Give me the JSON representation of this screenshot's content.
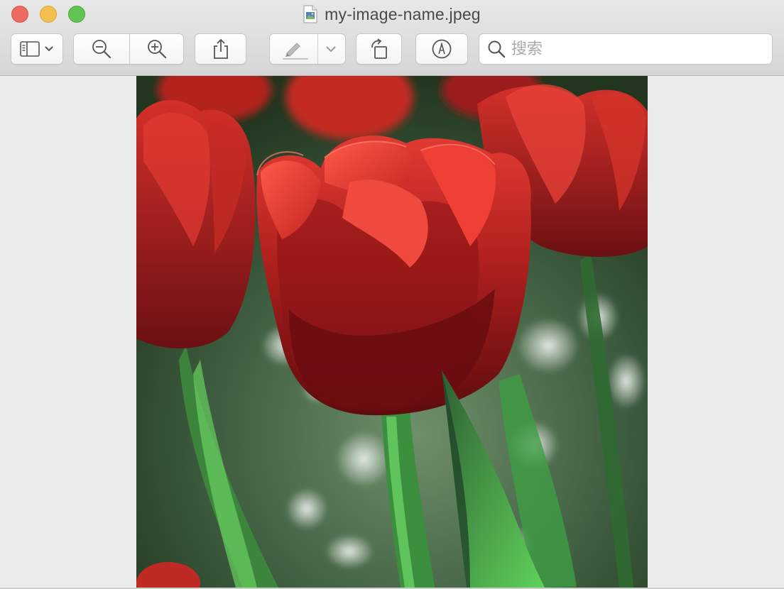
{
  "window": {
    "title": "my-image-name.jpeg"
  },
  "toolbar": {
    "sidebar_button": {
      "icon": "sidebar-icon",
      "menu_icon": "chevron-down-icon"
    },
    "zoom_out_button": {
      "icon": "zoom-out-icon"
    },
    "zoom_in_button": {
      "icon": "zoom-in-icon"
    },
    "share_button": {
      "icon": "share-icon"
    },
    "highlight_button": {
      "icon": "highlighter-pen-icon",
      "menu_icon": "chevron-down-icon"
    },
    "rotate_button": {
      "icon": "rotate-left-icon"
    },
    "markup_button": {
      "icon": "markup-pen-icon"
    },
    "search": {
      "icon": "search-icon",
      "placeholder": "搜索",
      "value": ""
    }
  },
  "content": {
    "image": {
      "subject": "red-tulip-photo"
    }
  },
  "colors": {
    "close": "#ed6a5e",
    "minimize": "#f5bf4f",
    "zoom": "#61c554",
    "viewer_background": "#ececec"
  }
}
